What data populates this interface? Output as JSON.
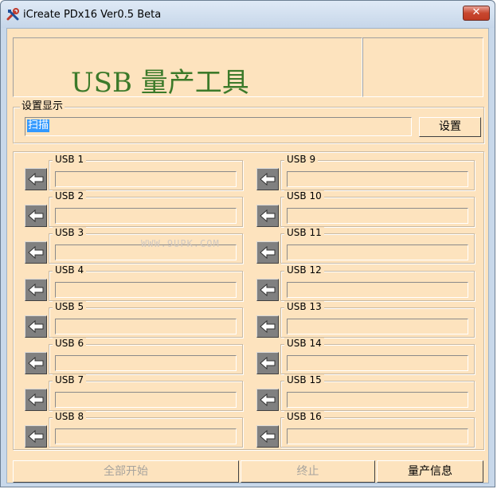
{
  "window": {
    "title": "iCreate PDx16 Ver0.5 Beta",
    "close_label": "✕"
  },
  "header": {
    "headline": "USB 量产工具"
  },
  "settings": {
    "group_label": "设置显示",
    "display_value": "扫描",
    "button_label": "设置"
  },
  "ports": [
    {
      "label": "USB 1"
    },
    {
      "label": "USB 2"
    },
    {
      "label": "USB 3"
    },
    {
      "label": "USB 4"
    },
    {
      "label": "USB 5"
    },
    {
      "label": "USB 6"
    },
    {
      "label": "USB 7"
    },
    {
      "label": "USB 8"
    },
    {
      "label": "USB 9"
    },
    {
      "label": "USB 10"
    },
    {
      "label": "USB 11"
    },
    {
      "label": "USB 12"
    },
    {
      "label": "USB 13"
    },
    {
      "label": "USB 14"
    },
    {
      "label": "USB 15"
    },
    {
      "label": "USB 16"
    }
  ],
  "watermark": "WWW.9UPK.COM",
  "actions": {
    "start_all": "全部开始",
    "stop": "终止",
    "production_info": "量产信息"
  },
  "colors": {
    "client_bg": "#fde3be",
    "headline": "#3c7a2a",
    "selection": "#3399ff"
  }
}
